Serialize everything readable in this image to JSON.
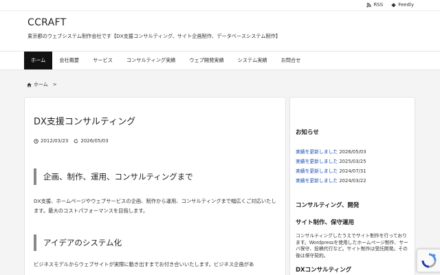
{
  "topbar": {
    "rss_label": "RSS",
    "feedly_label": "Feedly",
    "rss_icon": "rss-icon",
    "feedly_icon": "feedly-icon"
  },
  "header": {
    "site_title": "CCRAFT",
    "tagline": "東京都のウェブシステム制作会社です【DX支援コンサルティング、サイト企画制作、データベースシステム制作】"
  },
  "nav": {
    "items": [
      "ホーム",
      "会社概要",
      "サービス",
      "コンサルティング実績",
      "ウェブ開発実績",
      "システム実績",
      "お問合せ"
    ],
    "active_index": 0
  },
  "breadcrumb": {
    "home_label": "ホーム",
    "separator": ">"
  },
  "article": {
    "title": "DX支援コンサルティング",
    "published": "2012/03/23",
    "updated": "2026/05/03",
    "sections": [
      {
        "heading": "企画、制作、運用、コンサルティングまで",
        "body": "DX支援、ホームページやウェブサービスの企画、制作から運用、コンサルティングまで幅広くご対応いたします。最大のコストパフォーマンスを目指します。"
      },
      {
        "heading": "アイデアのシステム化",
        "body": "ビジネスモデルからウェブサイトが実際に動き出すまでお付き合いいたします。ビジネス企画があ"
      }
    ]
  },
  "sidebar": {
    "news_heading": "お知らせ",
    "news": [
      {
        "link": "実績を更新しました",
        "date": "2026/05/03"
      },
      {
        "link": "実績を更新しました",
        "date": "2025/03/25"
      },
      {
        "link": "実績を更新しました",
        "date": "2024/07/31"
      },
      {
        "link": "実績を更新しました",
        "date": "2024/03/22"
      }
    ],
    "heading2_line1": "コンサルティング、開発",
    "heading2_line2": "サイト制作、保守運用",
    "description": "コンサルティングしたうえでサイト制作を行っております。Wordpressを使用したホームページ制作、サーバ保守、投稿代行など。サイト制作は受託開発。その後は保守契約。",
    "heading3": "DXコンサルティング"
  },
  "colors": {
    "nav_active_bg": "#111111",
    "link": "#1a4fb4",
    "heading_bar": "#888888"
  }
}
